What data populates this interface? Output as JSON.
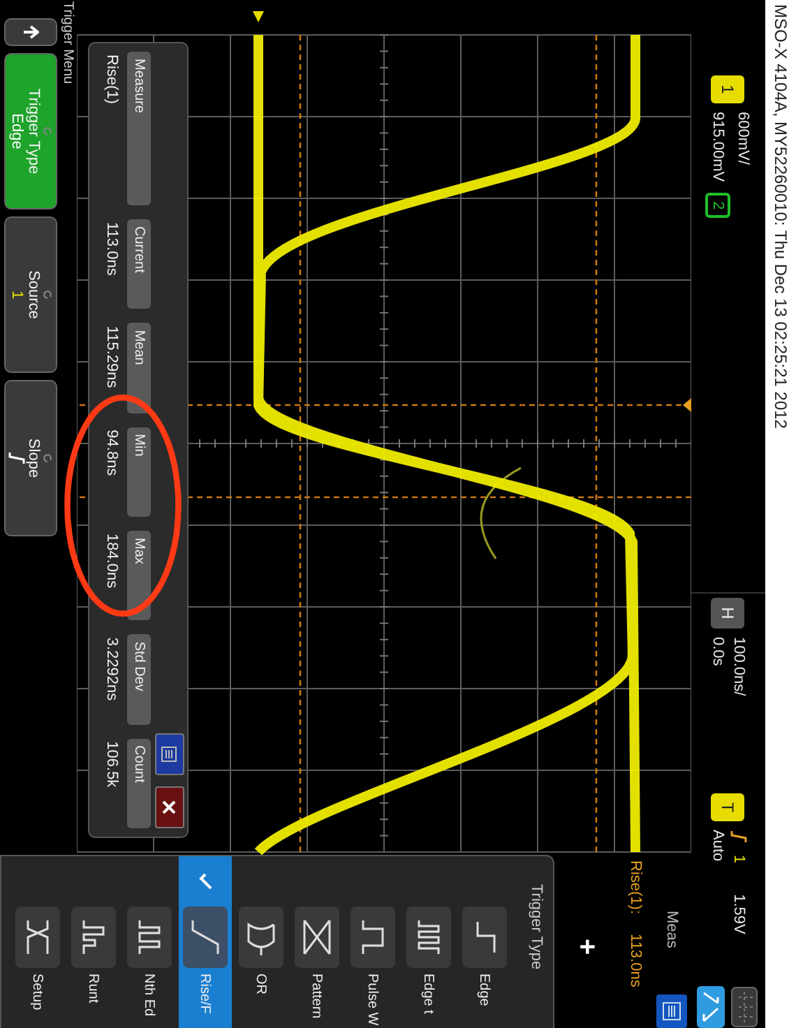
{
  "title": "MSO-X 4104A, MY52260010: Thu Dec 13 02:25:21 2012",
  "channels": [
    {
      "label": "1",
      "scale": "600mV/",
      "offset": "915.00mV",
      "color": "#e6dc00"
    },
    {
      "label": "2",
      "color": "#1fbf2a"
    }
  ],
  "horizontal": {
    "label": "H",
    "scale": "100.0ns/",
    "delay": "0.0s"
  },
  "trigger": {
    "label": "T",
    "source": "1",
    "level": "1.59V",
    "mode": "Auto"
  },
  "measurements": [
    {
      "label": "Measure",
      "value": "Rise(1)"
    },
    {
      "label": "Current",
      "value": "113.0ns"
    },
    {
      "label": "Mean",
      "value": "115.29ns"
    },
    {
      "label": "Min",
      "value": "94.8ns"
    },
    {
      "label": "Max",
      "value": "184.0ns"
    },
    {
      "label": "Std Dev",
      "value": "3.2292ns"
    },
    {
      "label": "Count",
      "value": "106.5k"
    }
  ],
  "meas_panel": {
    "title": "Meas",
    "items": [
      {
        "label": "Rise(1):",
        "value": "113.0ns"
      }
    ],
    "add": "+"
  },
  "trigger_type": {
    "title": "Trigger Type",
    "items": [
      {
        "label": "Edge",
        "selected": false
      },
      {
        "label": "Edge t",
        "selected": false
      },
      {
        "label": "Pulse W",
        "selected": false
      },
      {
        "label": "Pattern",
        "selected": false
      },
      {
        "label": "OR",
        "selected": false
      },
      {
        "label": "Rise/F",
        "selected": true
      },
      {
        "label": "Nth Ed",
        "selected": false
      },
      {
        "label": "Runt",
        "selected": false
      },
      {
        "label": "Setup",
        "selected": false
      }
    ]
  },
  "softkeys": {
    "title": "Trigger Menu",
    "keys": [
      {
        "kind": "back",
        "selected": false
      },
      {
        "kind": "menu",
        "title": "Trigger Type",
        "value": "Edge",
        "selected": true
      },
      {
        "kind": "menu",
        "title": "Source",
        "value": "1",
        "selected": false
      },
      {
        "kind": "slope",
        "title": "Slope",
        "selected": false
      }
    ]
  }
}
